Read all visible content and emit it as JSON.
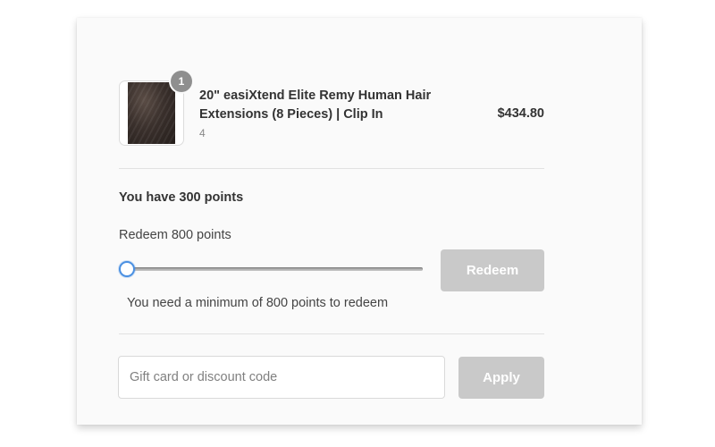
{
  "cart": {
    "item": {
      "name": "20\" easiXtend Elite Remy Human Hair Extensions (8 Pieces) | Clip In",
      "variant": "4",
      "price": "$434.80",
      "quantity": "1",
      "image_icon": "hair-extension-product-image"
    }
  },
  "rewards": {
    "points_balance_text": "You have 300 points",
    "redeem_label": "Redeem 800 points",
    "slider_value_fraction": 0,
    "redeem_button": "Redeem",
    "minimum_note": "You need a minimum of 800 points to redeem"
  },
  "discount": {
    "placeholder": "Gift card or discount code",
    "value": "",
    "apply_button": "Apply"
  },
  "colors": {
    "card_background": "#fafafa",
    "disabled_button": "#c9c9c9",
    "slider_thumb_border": "#4a90e2",
    "quantity_badge": "#8f8f8f"
  }
}
